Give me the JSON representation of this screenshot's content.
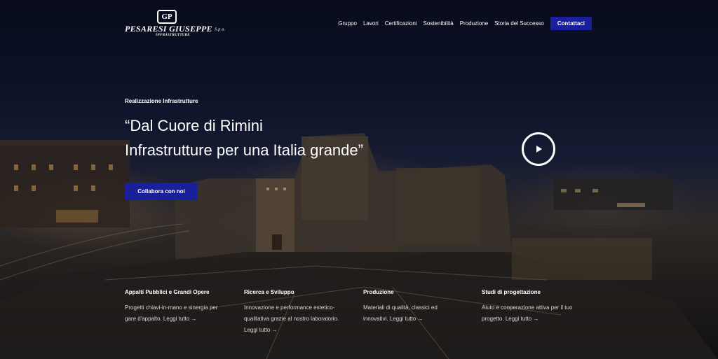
{
  "header": {
    "logo": {
      "mark": "GP",
      "name": "PESARESI GIUSEPPE",
      "spa": "S.p.a.",
      "sub": "INFRASTRUTTURE"
    },
    "nav": [
      "Gruppo",
      "Lavori",
      "Certificazioni",
      "Sostenibilità",
      "Produzione",
      "Storia del Successo"
    ],
    "cta": "Contattaci"
  },
  "hero": {
    "eyebrow": "Realizzazione Infrastrutture",
    "headline_line1": "“Dal Cuore di Rimini",
    "headline_line2": "Infrastrutture per una Italia grande”",
    "cta": "Collabora con noi",
    "play_icon": "play-icon"
  },
  "features": [
    {
      "title": "Appalti Pubblici e Grandi Opere",
      "desc": "Progetti chiavi-in-mano e sinergia per gare d'appalto.",
      "link": "Leggi tutto →"
    },
    {
      "title": "Ricerca e Sviluppo",
      "desc": "Innovazione e performance estetico-qualitativa grazie al nostro laboratorio.",
      "link": "Leggi tutto →"
    },
    {
      "title": "Produzione",
      "desc": "Materiali di qualità, classici ed innovativi.",
      "link": "Leggi tutto →"
    },
    {
      "title": "Studi di progettazione",
      "desc": "Aiuto e cooperazione attiva per il tuo progetto.",
      "link": "Leggi tutto →"
    }
  ],
  "colors": {
    "accent": "#1a1f9c",
    "sky": "#131a36"
  }
}
